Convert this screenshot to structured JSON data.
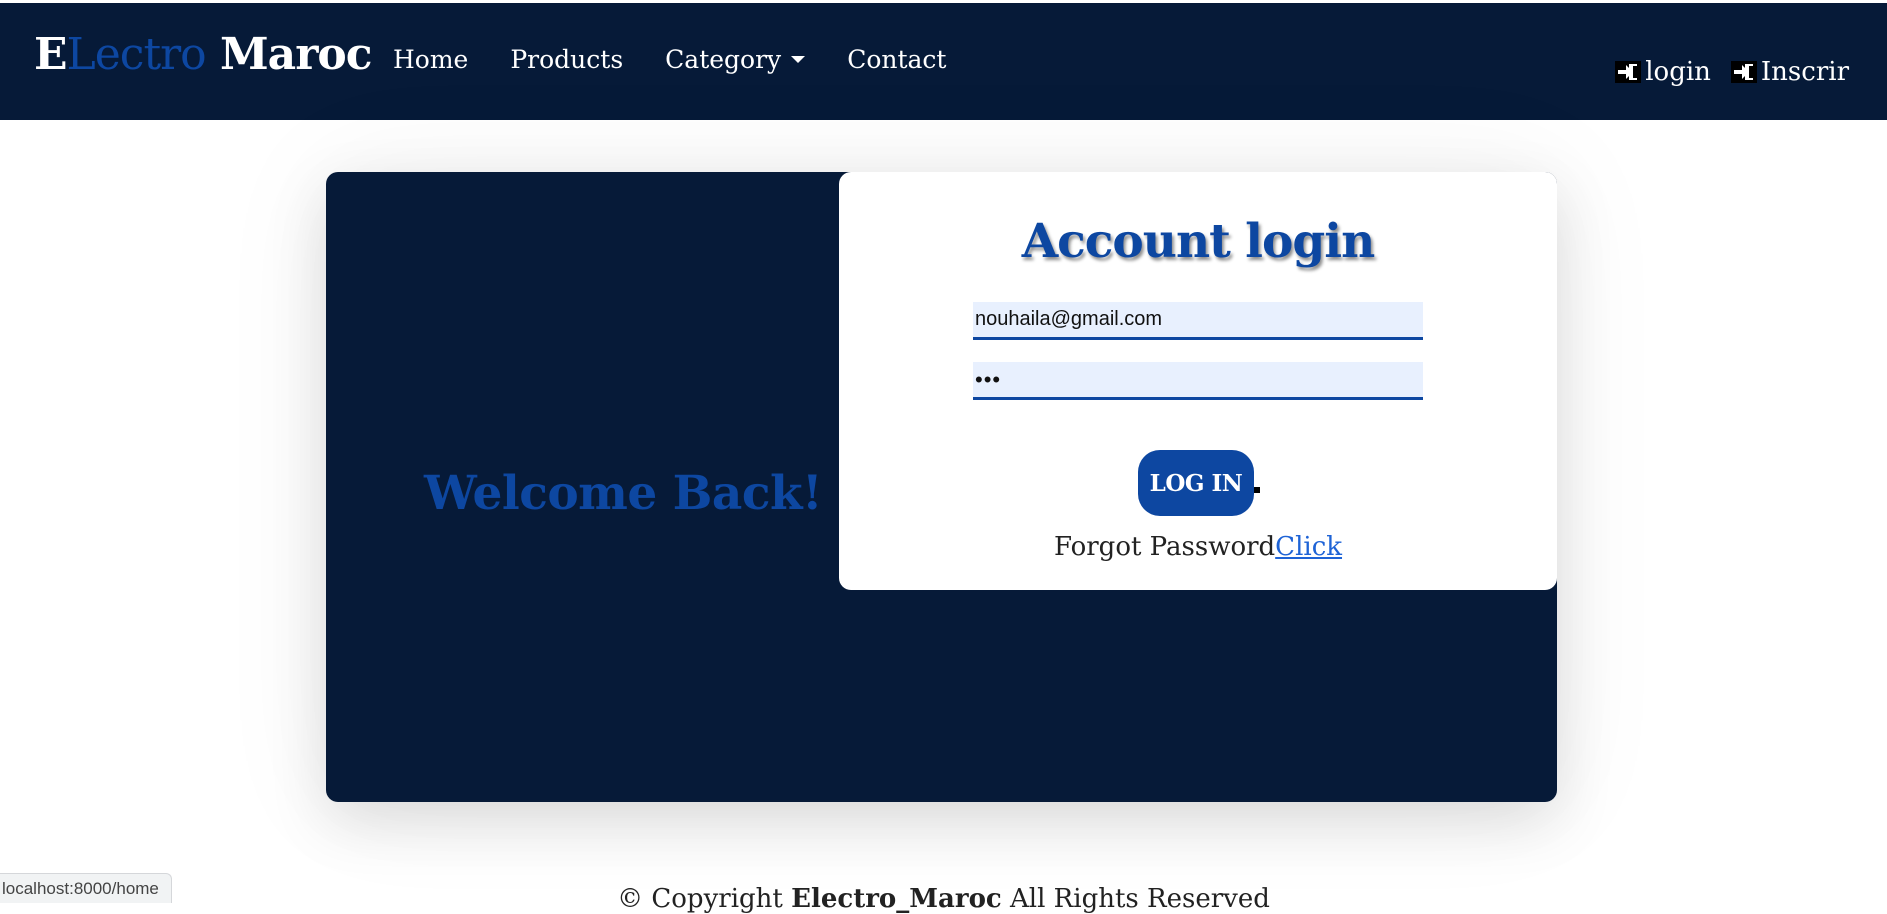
{
  "brand": {
    "first_letter": "E",
    "accent_part": "Lectro",
    "rest": " Maroc"
  },
  "nav": {
    "home": "Home",
    "products": "Products",
    "category": "Category",
    "contact": "Contact"
  },
  "auth": {
    "login": "login",
    "register": "Inscrir",
    "icon": "sign-in-icon"
  },
  "welcome": "Welcome Back!",
  "login_form": {
    "title": "Account login",
    "email_value": "nouhaila@gmail.com",
    "password_value": "•••",
    "button_label": "LOG IN",
    "forgot_text": "Forgot Password",
    "forgot_link": "Click"
  },
  "footer": {
    "prefix": "© Copyright ",
    "brand": "Electro_Maroc",
    "suffix": " All Rights Reserved"
  },
  "status_url": "localhost:8000/home",
  "colors": {
    "navbar_bg": "#061a38",
    "accent_blue": "#0d47a1",
    "link_blue": "#1e63d6",
    "field_bg": "#e8f0fe"
  }
}
